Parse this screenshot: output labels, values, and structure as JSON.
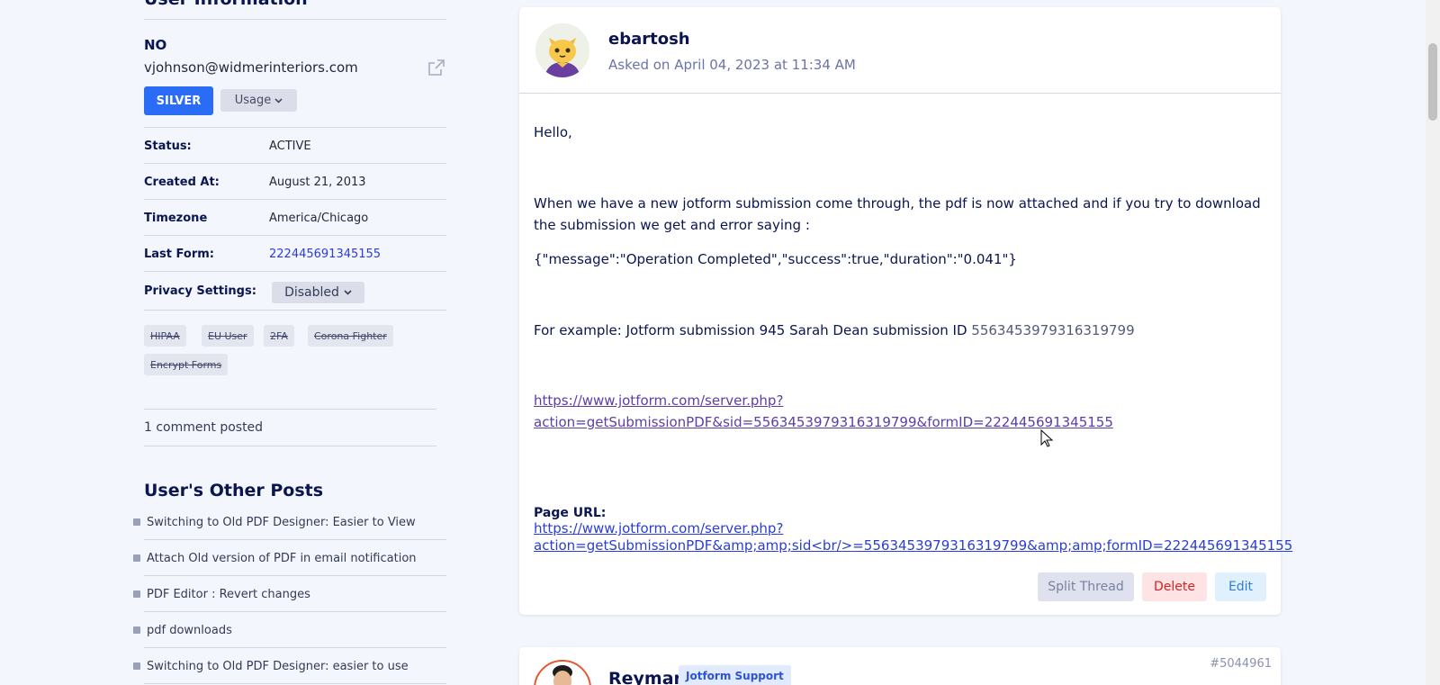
{
  "sidebar": {
    "heading_cut": "User Information",
    "name": "NO",
    "email": "vjohnson@widmerinteriors.com",
    "plan_label": "SILVER",
    "usage_label": "Usage",
    "rows": [
      {
        "label": "Status:",
        "value": "ACTIVE"
      },
      {
        "label": "Created At:",
        "value": "August 21, 2013"
      },
      {
        "label": "Timezone",
        "value": "America/Chicago"
      },
      {
        "label": "Last Form:",
        "value": "222445691345155"
      },
      {
        "label": "Privacy Settings:",
        "value": "Disabled"
      }
    ],
    "tags": [
      "HIPAA",
      "EU User",
      "2FA",
      "Corona Fighter",
      "Encrypt Forms"
    ],
    "comment_count": "1 comment posted",
    "other_posts_title": "User's Other Posts",
    "other_posts": [
      "Switching to Old PDF Designer: Easier to View",
      "Attach Old version of PDF in email notification",
      "PDF Editor : Revert changes",
      "pdf downloads",
      "Switching to Old PDF Designer: easier to use"
    ]
  },
  "question": {
    "user": "ebartosh",
    "asked_on": "Asked on April 04, 2023 at 11:34 AM",
    "greeting": "Hello,",
    "paragraph1": "When we have a new jotform submission come through, the pdf is now attached and if you try to download the submission we get and error saying :",
    "json_msg": "{\"message\":\"Operation Completed\",\"success\":true,\"duration\":\"0.041\"}",
    "example_prefix": "For example: Jotform submission 945 Sarah Dean submission ID ",
    "example_id": "5563453979316319799",
    "link1_line1": "https://www.jotform.com/server.php?",
    "link1_line2": "action=getSubmissionPDF&sid=5563453979316319799&formID=222445691345155",
    "page_url_label": "Page URL:",
    "link2_line1": "https://www.jotform.com/server.php?",
    "link2_line2": "action=getSubmissionPDF&amp;amp;sid<br/>=5563453979316319799&amp;amp;formID=222445691345155",
    "buttons": {
      "split": "Split Thread",
      "delete": "Delete",
      "edit": "Edit"
    }
  },
  "reply": {
    "user": "Reymar",
    "badge": "Jotform Support",
    "post_id": "#5044961"
  },
  "colors": {
    "accent": "#2b6cf6",
    "text": "#0a1551",
    "delete": "#d52424",
    "edit": "#2e7fd4"
  }
}
